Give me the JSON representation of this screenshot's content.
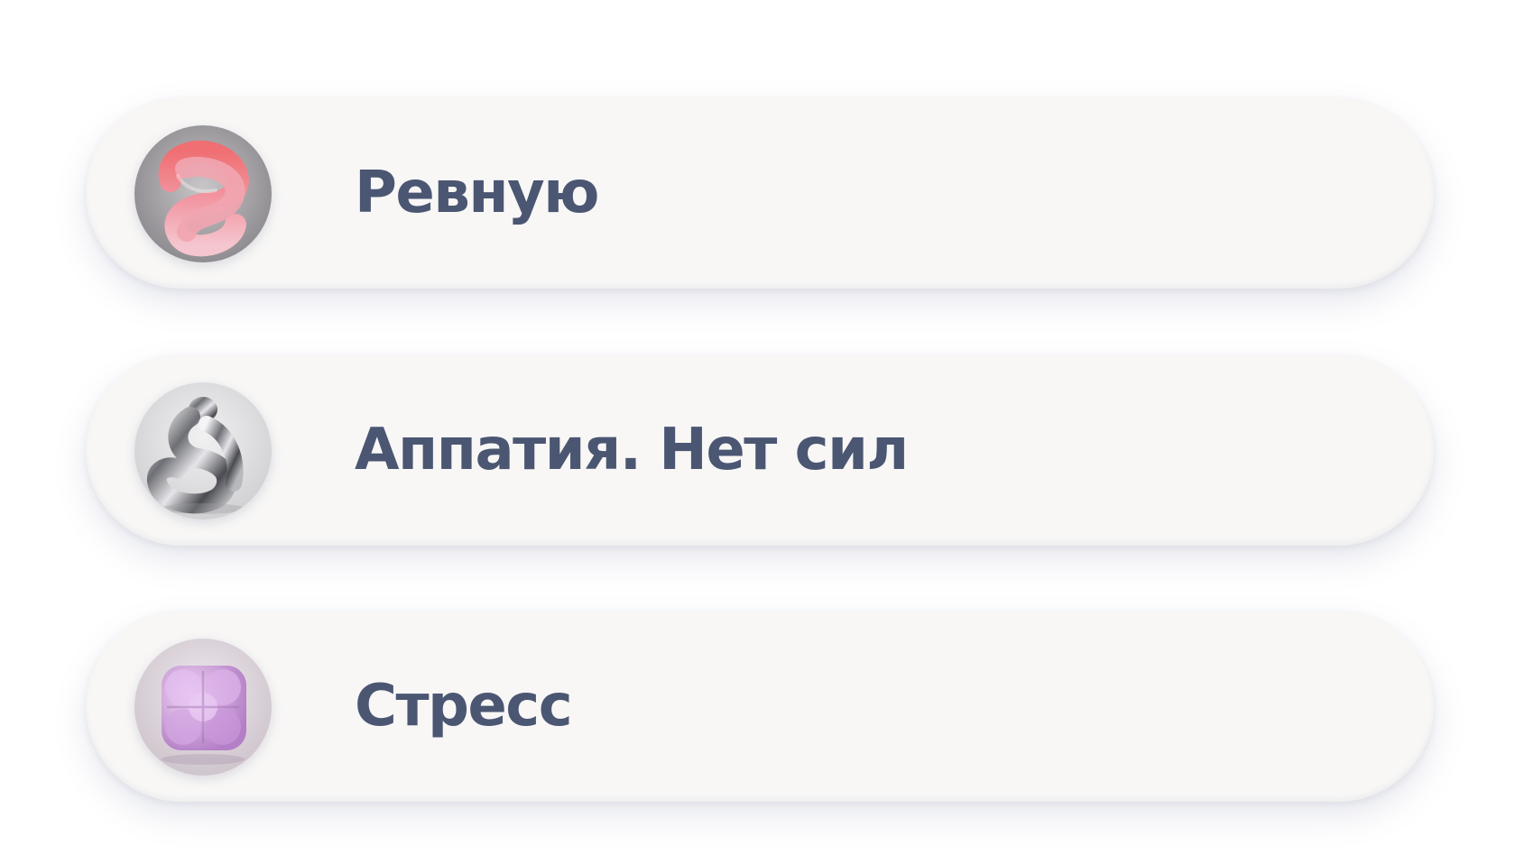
{
  "topics": [
    {
      "label": "Ревную",
      "icon": "knot-sculpture-icon",
      "accent": "#e8707f"
    },
    {
      "label": "Аппатия. Нет сил",
      "icon": "chrome-figure-icon",
      "accent": "#8e8e96"
    },
    {
      "label": "Стресс",
      "icon": "puffy-cube-icon",
      "accent": "#c79ad6"
    }
  ],
  "colors": {
    "text": "#4b5672",
    "card": "#f8f7f6"
  }
}
